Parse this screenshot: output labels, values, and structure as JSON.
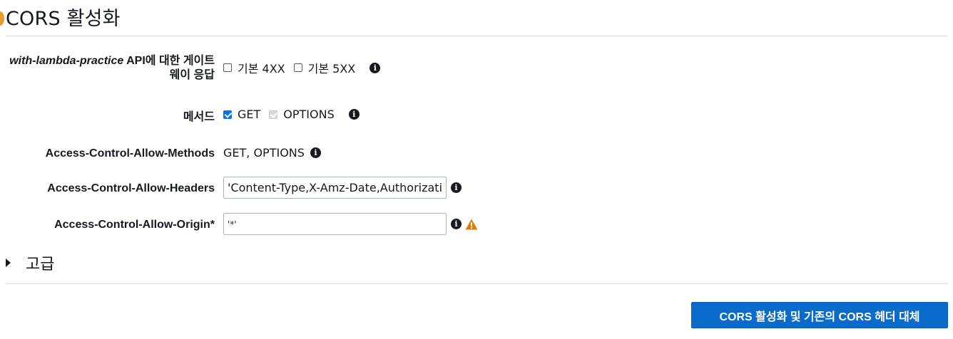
{
  "title": "CORS 활성화",
  "gateway_response": {
    "label_api_name": "with-lambda-practice",
    "label_suffix": " API에 대한 게이트웨이 응답",
    "options": [
      {
        "label": "기본 4XX",
        "checked": false
      },
      {
        "label": "기본 5XX",
        "checked": false
      }
    ]
  },
  "methods": {
    "label": "메서드",
    "options": [
      {
        "label": "GET",
        "checked": true,
        "disabled": false
      },
      {
        "label": "OPTIONS",
        "checked": true,
        "disabled": true
      }
    ]
  },
  "allow_methods": {
    "label": "Access-Control-Allow-Methods",
    "value": "GET, OPTIONS"
  },
  "allow_headers": {
    "label": "Access-Control-Allow-Headers",
    "value": "'Content-Type,X-Amz-Date,Authorization,X-Api-Key,X-Amz-Security-Token'"
  },
  "allow_origin": {
    "label": "Access-Control-Allow-Origin*",
    "value": "'*'"
  },
  "advanced": {
    "label": "고급"
  },
  "submit_button": {
    "label": "CORS 활성화 및 기존의 CORS 헤더 대체"
  },
  "icons": {
    "info": "info-icon",
    "warning": "warning-icon",
    "expand": "caret-right-icon"
  },
  "colors": {
    "primary_button": "#0b6bcb",
    "checkbox_checked": "#0a72e8",
    "warning": "#e07b00"
  }
}
